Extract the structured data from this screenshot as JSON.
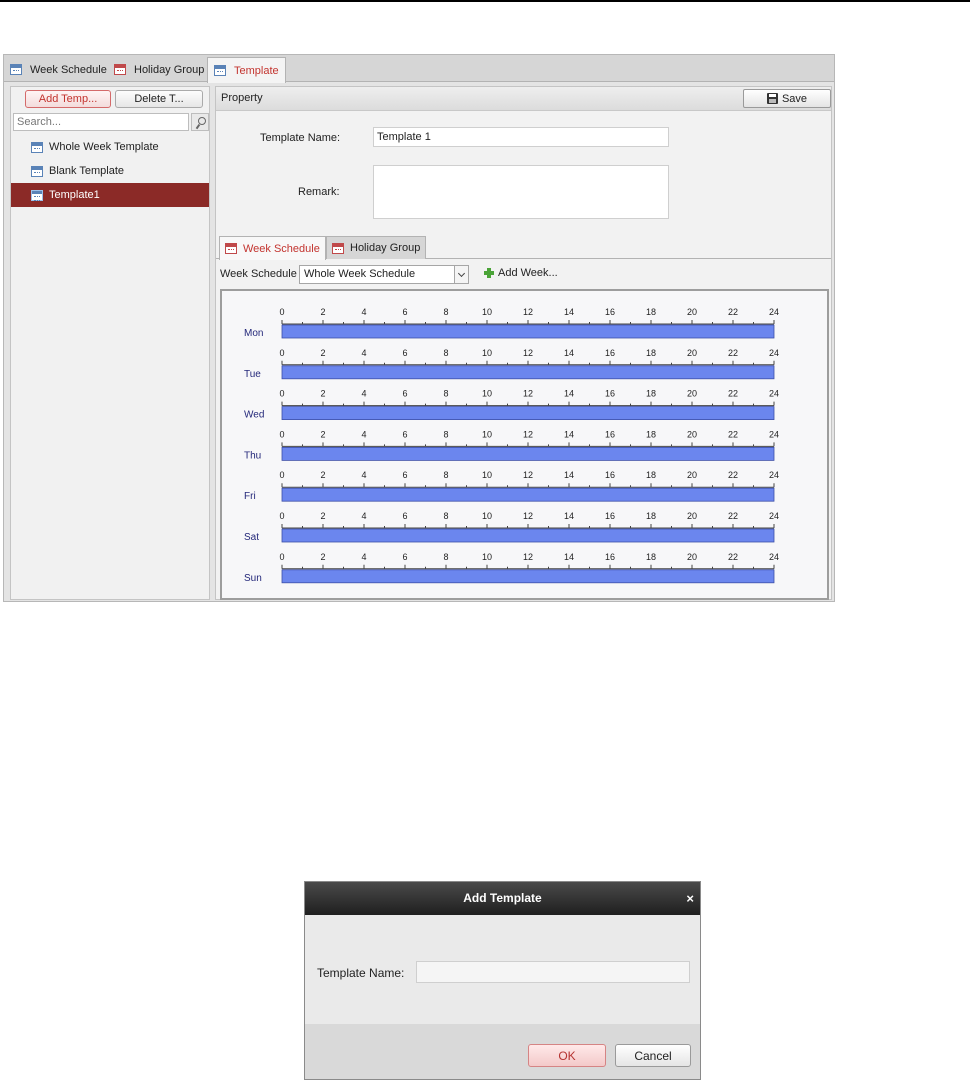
{
  "tabs": [
    {
      "label": "Week Schedule",
      "icon": "calendar-icon"
    },
    {
      "label": "Holiday Group",
      "icon": "holiday-calendar-icon"
    },
    {
      "label": "Template",
      "icon": "calendar-icon",
      "active": true
    }
  ],
  "left_panel": {
    "add_button": "Add Temp...",
    "delete_button": "Delete T...",
    "search_placeholder": "Search...",
    "templates": [
      {
        "label": "Whole Week Template"
      },
      {
        "label": "Blank Template"
      },
      {
        "label": "Template1",
        "selected": true
      }
    ]
  },
  "property": {
    "header": "Property",
    "save_label": "Save",
    "template_name_label": "Template Name:",
    "template_name_value": "Template 1",
    "remark_label": "Remark:",
    "remark_value": ""
  },
  "sub_tabs": [
    {
      "label": "Week Schedule",
      "active": true
    },
    {
      "label": "Holiday Group"
    }
  ],
  "week_schedule": {
    "label": "Week Schedule",
    "selected": "Whole Week Schedule",
    "add_week_label": "Add Week..."
  },
  "schedule": {
    "hour_labels": [
      "0",
      "2",
      "4",
      "6",
      "8",
      "10",
      "12",
      "14",
      "16",
      "18",
      "20",
      "22",
      "24"
    ],
    "days": [
      {
        "name": "Mon",
        "start": 0,
        "end": 24
      },
      {
        "name": "Tue",
        "start": 0,
        "end": 24
      },
      {
        "name": "Wed",
        "start": 0,
        "end": 24
      },
      {
        "name": "Thu",
        "start": 0,
        "end": 24
      },
      {
        "name": "Fri",
        "start": 0,
        "end": 24
      },
      {
        "name": "Sat",
        "start": 0,
        "end": 24
      },
      {
        "name": "Sun",
        "start": 0,
        "end": 24
      }
    ],
    "bar_color": "#6b86ee",
    "day_label_color": "#24287a"
  },
  "dialog": {
    "title": "Add Template",
    "close": "×",
    "name_label": "Template Name:",
    "name_value": "",
    "ok_label": "OK",
    "cancel_label": "Cancel"
  },
  "colors": {
    "accent_red": "#c3342f",
    "selected_row": "#8b2a27"
  }
}
